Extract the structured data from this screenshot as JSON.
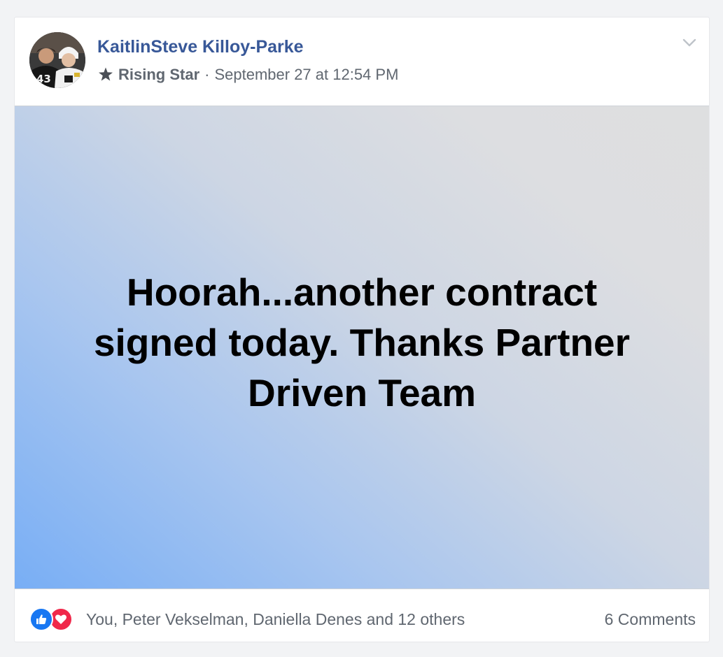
{
  "post": {
    "author": {
      "name": "KaitlinSteve Killoy-Parke",
      "avatar_icon": "profile-photo"
    },
    "badge": {
      "icon": "star-icon",
      "label": "Rising Star"
    },
    "separator": "·",
    "timestamp": "September 27 at 12:54 PM",
    "options_icon": "chevron-down-icon",
    "text": "Hoorah...another contract signed today. Thanks Partner Driven Team",
    "background_colors": [
      "#78aef5",
      "#dedfe0"
    ]
  },
  "footer": {
    "reaction_icons": [
      "like-icon",
      "love-icon"
    ],
    "reactors_text": "You, Peter Vekselman, Daniella Denes and 12 others",
    "comments_text": "6 Comments"
  },
  "colors": {
    "link": "#385898",
    "meta": "#606770",
    "like": "#1877f2",
    "love": "#f0284a"
  }
}
